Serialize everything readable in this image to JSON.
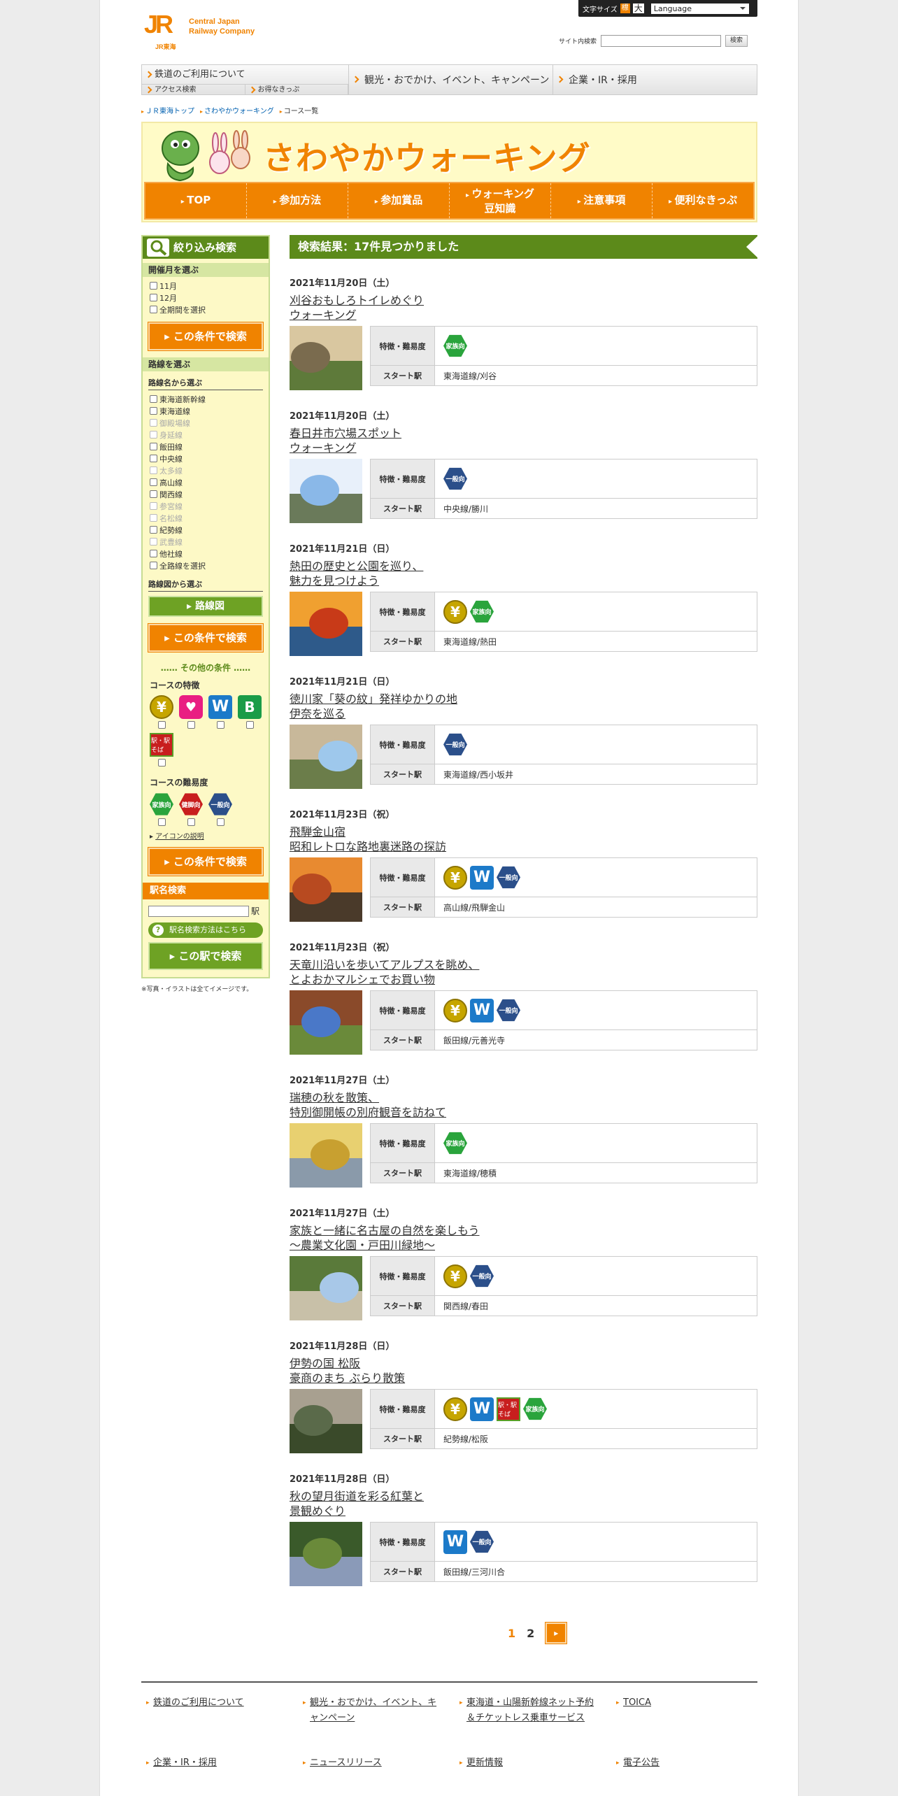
{
  "header": {
    "logo_jr": "JR",
    "logo_sub": "JR東海",
    "company_line1": "Central Japan",
    "company_line2": "Railway Company",
    "font_size_label": "文字サイズ",
    "font_small": "標",
    "font_large": "大",
    "language": "Language",
    "site_search_label": "サイト内検索",
    "site_search_button": "検索"
  },
  "gnav": {
    "rail_main": "鉄道のご利用について",
    "rail_sub1": "アクセス検索",
    "rail_sub2": "お得なきっぷ",
    "item2": "観光・おでかけ、イベント、キャンペーン",
    "item3": "企業・IR・採用"
  },
  "breadcrumb": [
    "ＪＲ東海トップ",
    "さわやかウォーキング",
    "コース一覧"
  ],
  "banner": {
    "title": "さわやかウォーキング",
    "nav": [
      "TOP",
      "参加方法",
      "参加賞品",
      "ウォーキング\n豆知識",
      "注意事項",
      "便利なきっぷ"
    ]
  },
  "sidebar": {
    "title": "絞り込み検索",
    "month_head": "開催月を選ぶ",
    "months": [
      "11月",
      "12月",
      "全期間を選択"
    ],
    "search_button": "この条件で検索",
    "line_head": "路線を選ぶ",
    "line_group": "路線名から選ぶ",
    "lines": [
      {
        "name": "東海道新幹線",
        "enabled": true
      },
      {
        "name": "東海道線",
        "enabled": true
      },
      {
        "name": "御殿場線",
        "enabled": false
      },
      {
        "name": "身延線",
        "enabled": false
      },
      {
        "name": "飯田線",
        "enabled": true
      },
      {
        "name": "中央線",
        "enabled": true
      },
      {
        "name": "太多線",
        "enabled": false
      },
      {
        "name": "高山線",
        "enabled": true
      },
      {
        "name": "関西線",
        "enabled": true
      },
      {
        "name": "参宮線",
        "enabled": false
      },
      {
        "name": "名松線",
        "enabled": false
      },
      {
        "name": "紀勢線",
        "enabled": true
      },
      {
        "name": "武豊線",
        "enabled": false
      },
      {
        "name": "他社線",
        "enabled": true
      },
      {
        "name": "全路線を選択",
        "enabled": true
      }
    ],
    "map_group": "路線図から選ぶ",
    "map_button": "路線図",
    "other_conditions": "その他の条件",
    "feature_label": "コースの特徴",
    "difficulty_label": "コースの難易度",
    "icon_link": "アイコンの説明",
    "station_head": "駅名検索",
    "station_suffix": "駅",
    "station_help": "駅名検索方法はこちら",
    "station_button": "この駅で検索",
    "note": "※写真・イラストは全てイメージです。"
  },
  "icons": {
    "yen": "¥",
    "w": "W",
    "w_sub": "ポイント",
    "b": "B",
    "b_sub": "特典",
    "eki": "駅・駅そば",
    "family": "家族向",
    "healthy": "健脚向",
    "general": "一般向"
  },
  "main": {
    "result_header": "検索結果：17件見つかりました",
    "feature_label": "特徴・難易度",
    "start_label": "スタート駅",
    "results": [
      {
        "date": "2021年11月20日（土）",
        "title1": "刈谷おもしろトイレめぐり",
        "title2": "ウォーキング",
        "icons": [
          "family"
        ],
        "station": "東海道線/刈谷"
      },
      {
        "date": "2021年11月20日（土）",
        "title1": "春日井市穴場スポット",
        "title2": "ウォーキング",
        "icons": [
          "general"
        ],
        "station": "中央線/勝川"
      },
      {
        "date": "2021年11月21日（日）",
        "title1": "熱田の歴史と公園を巡り、",
        "title2": "魅力を見つけよう",
        "icons": [
          "yen",
          "family"
        ],
        "station": "東海道線/熱田"
      },
      {
        "date": "2021年11月21日（日）",
        "title1": "徳川家「葵の紋」発祥ゆかりの地",
        "title2": "伊奈を巡る",
        "icons": [
          "general"
        ],
        "station": "東海道線/西小坂井"
      },
      {
        "date": "2021年11月23日（祝）",
        "title1": "飛騨金山宿",
        "title2": "昭和レトロな路地裏迷路の探訪",
        "icons": [
          "yen",
          "w",
          "general"
        ],
        "station": "高山線/飛騨金山"
      },
      {
        "date": "2021年11月23日（祝）",
        "title1": "天竜川沿いを歩いてアルプスを眺め、",
        "title2": "とよおかマルシェでお買い物",
        "icons": [
          "yen",
          "w",
          "general"
        ],
        "station": "飯田線/元善光寺"
      },
      {
        "date": "2021年11月27日（土）",
        "title1": "瑞穂の秋を散策、",
        "title2": "特別御開帳の別府観音を訪ねて",
        "icons": [
          "family"
        ],
        "station": "東海道線/穂積"
      },
      {
        "date": "2021年11月27日（土）",
        "title1": "家族と一緒に名古屋の自然を楽しもう",
        "title2": "～農業文化園・戸田川緑地～",
        "icons": [
          "yen",
          "general"
        ],
        "station": "関西線/春田"
      },
      {
        "date": "2021年11月28日（日）",
        "title1": "伊勢の国 松阪",
        "title2": "豪商のまち ぶらり散策",
        "icons": [
          "yen",
          "w",
          "eki",
          "family"
        ],
        "station": "紀勢線/松阪"
      },
      {
        "date": "2021年11月28日（日）",
        "title1": "秋の望月街道を彩る紅葉と",
        "title2": "景観めぐり",
        "icons": [
          "w",
          "general"
        ],
        "station": "飯田線/三河川合"
      }
    ],
    "pages": [
      "1",
      "2"
    ],
    "next": "▸"
  },
  "footer": {
    "links": [
      "鉄道のご利用について",
      "観光・おでかけ、イベント、キャンペーン",
      "東海道・山陽新幹線ネット予約＆チケットレス乗車サービス",
      "TOICA",
      "企業・IR・採用",
      "ニュースリリース",
      "更新情報",
      "電子公告"
    ]
  },
  "colors": {
    "accent": "#f08300",
    "green": "#5c8a1a",
    "sidebar_bg": "#fdf9c6"
  }
}
